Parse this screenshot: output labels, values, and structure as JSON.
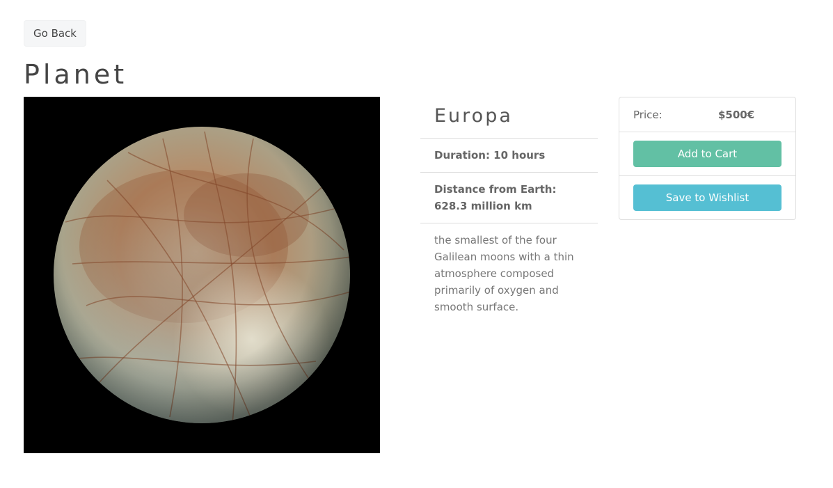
{
  "nav": {
    "back_label": "Go Back"
  },
  "page": {
    "title": "Planet"
  },
  "product": {
    "name": "Europa",
    "duration": "Duration: 10 hours",
    "distance": "Distance from Earth: 628.3 million km",
    "description": "the smallest of the four Galilean moons with a thin atmosphere composed primarily of oxygen and smooth surface.",
    "image_alt": "Europa"
  },
  "purchase": {
    "price_label": "Price:",
    "price_value": "$500€",
    "add_to_cart_label": "Add to Cart",
    "save_to_wishlist_label": "Save to Wishlist"
  },
  "colors": {
    "add_to_cart": "#62c0a4",
    "save_to_wishlist": "#55bfd3"
  }
}
